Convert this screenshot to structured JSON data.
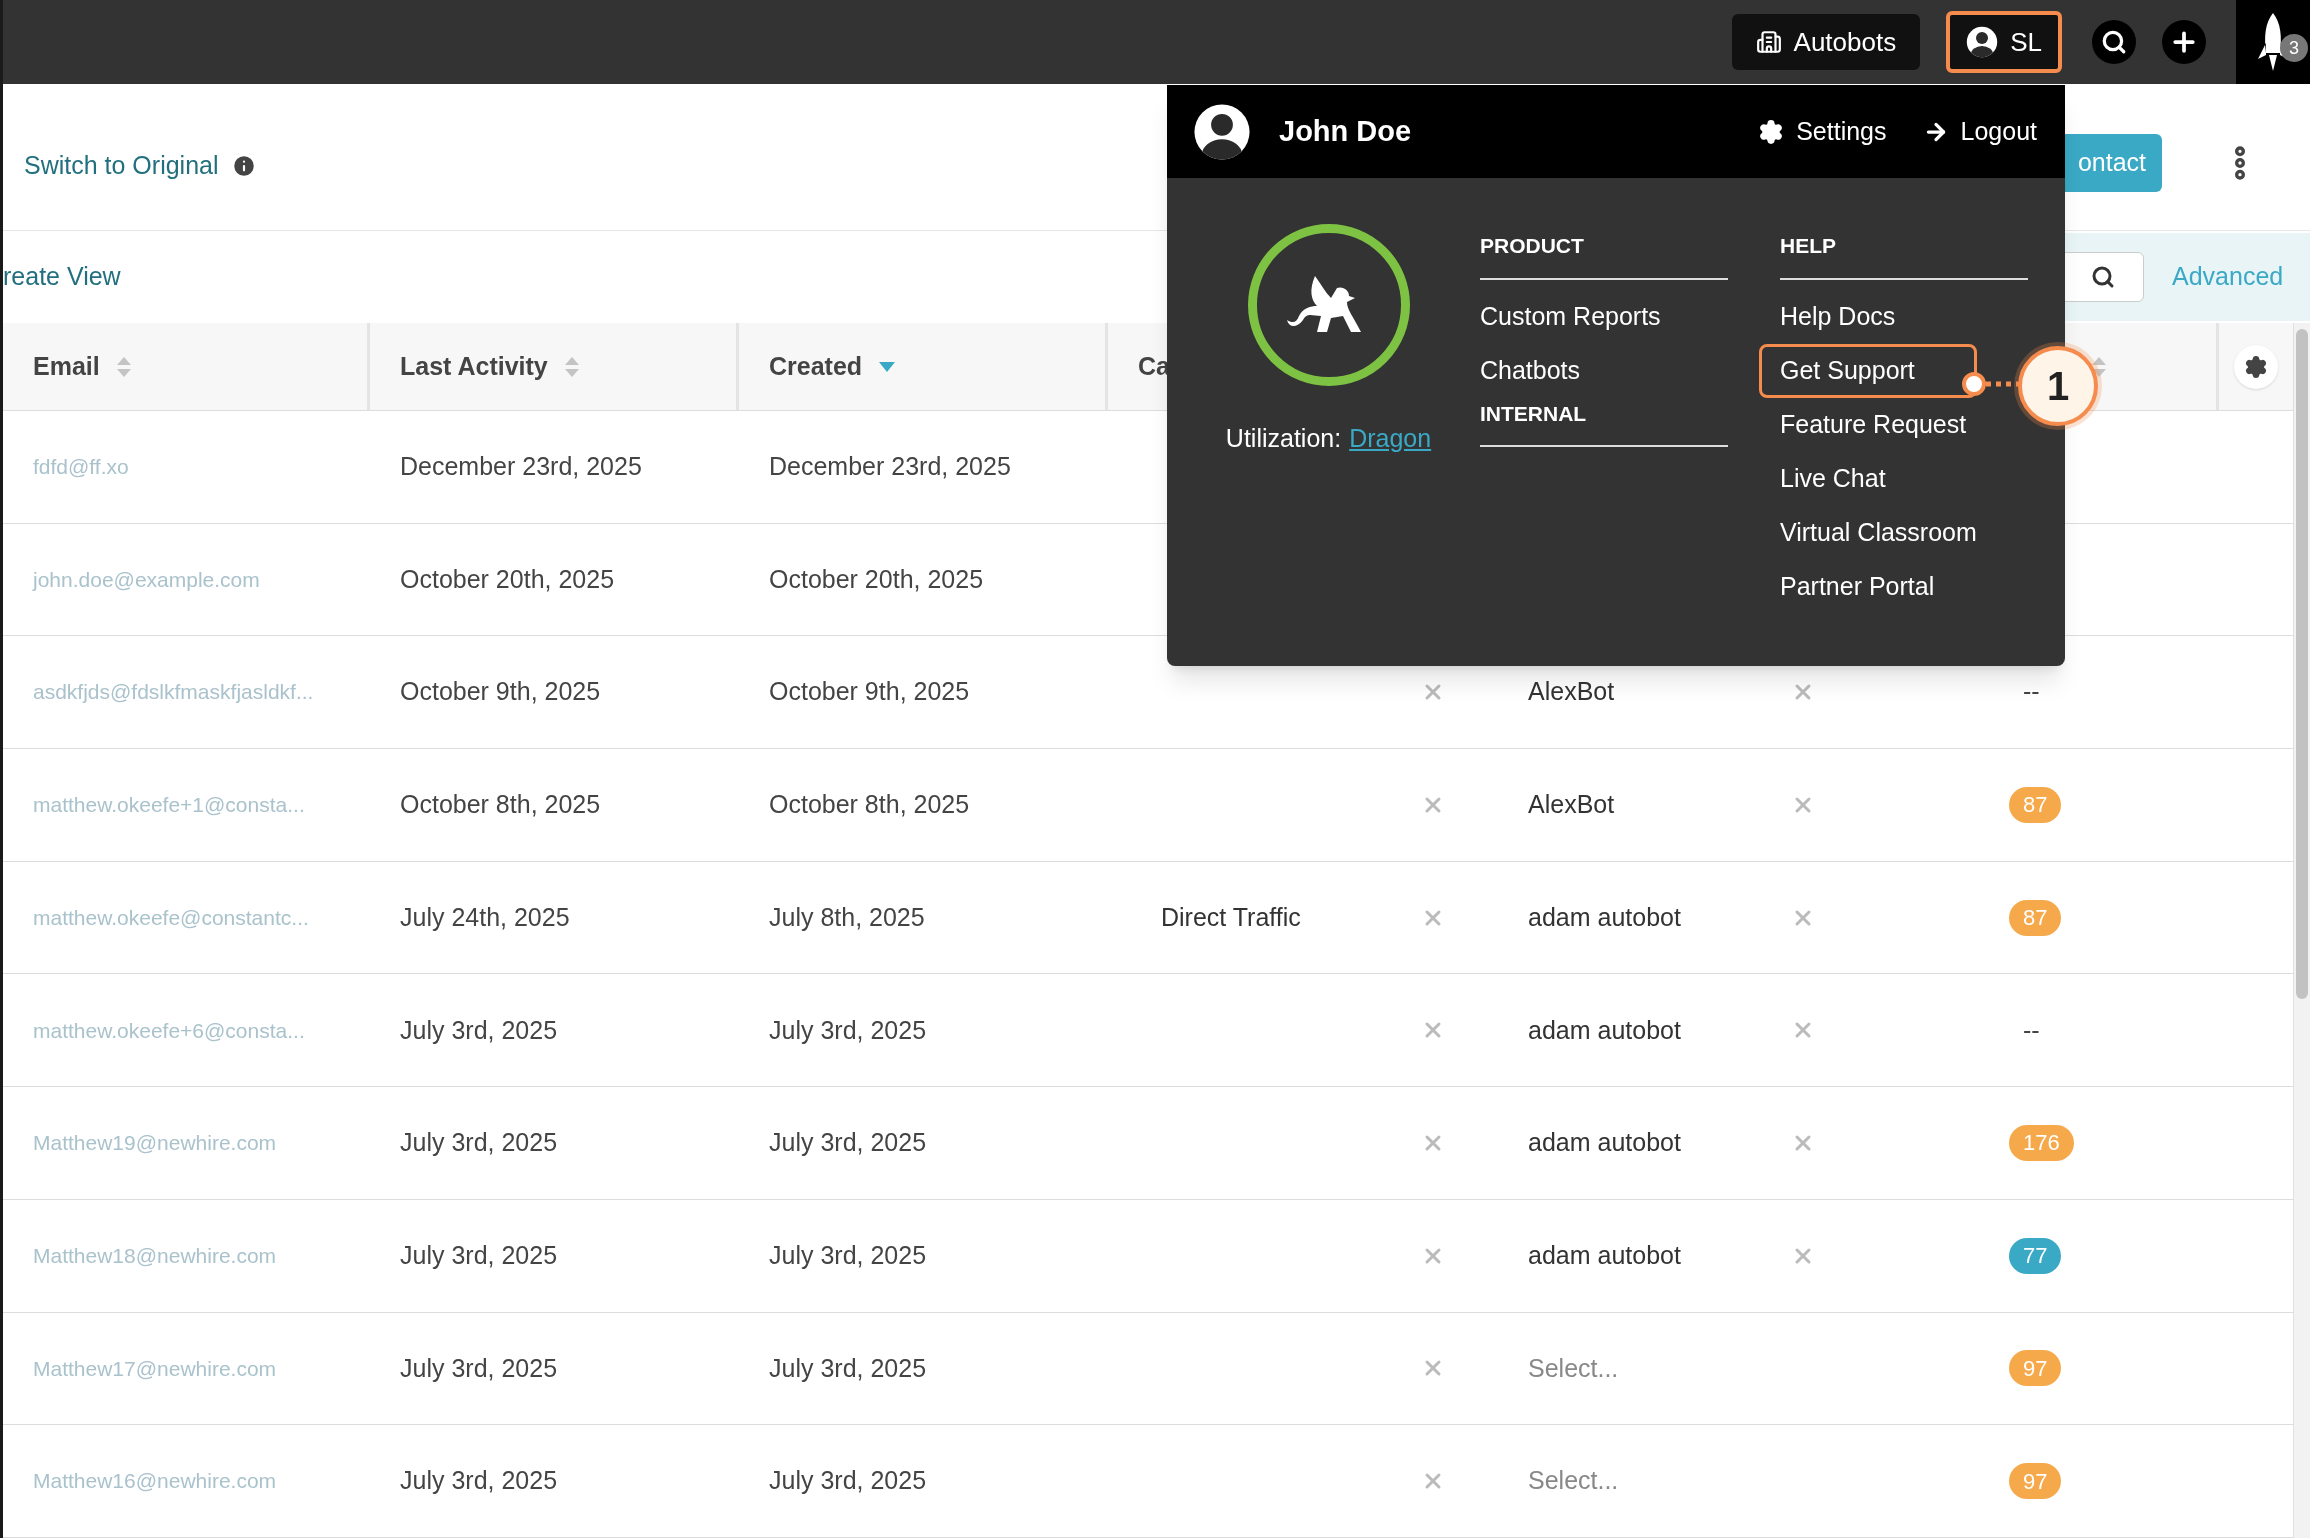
{
  "top_bar": {
    "account_button": "Autobots",
    "user_button": {
      "initials": "SL",
      "highlighted": true
    },
    "notification_count": "3"
  },
  "page_header": {
    "switch_link": "Switch to Original",
    "primary_button": "ontact"
  },
  "view_bar": {
    "create_view_link": "reate View",
    "advanced_link": "Advanced"
  },
  "table": {
    "columns": [
      {
        "label": "Email",
        "sorted": false
      },
      {
        "label": "Last Activity",
        "sorted": false
      },
      {
        "label": "Created",
        "sorted": true
      },
      {
        "label": "Ca"
      }
    ],
    "score_column": {
      "sorted": false
    },
    "rows": [
      {
        "email": "fdfd@ff.xo",
        "last_activity": "December 23rd, 2025",
        "created": "December 23rd, 2025"
      },
      {
        "email": "john.doe@example.com",
        "last_activity": "October 20th, 2025",
        "created": "October 20th, 2025"
      },
      {
        "email": "asdkfjds@fdslkfmaskfjasldkf...",
        "last_activity": "October 9th, 2025",
        "created": "October 9th, 2025",
        "bot": {
          "value": "AlexBot"
        },
        "score": {
          "text": "--"
        }
      },
      {
        "email": "matthew.okeefe+1@consta...",
        "last_activity": "October 8th, 2025",
        "created": "October 8th, 2025",
        "bot": {
          "value": "AlexBot"
        },
        "score": {
          "text": "87",
          "color": "#f5a94a"
        }
      },
      {
        "email": "matthew.okeefe@constantc...",
        "last_activity": "July 24th, 2025",
        "created": "July 8th, 2025",
        "column_4": "Direct Traffic",
        "bot": {
          "value": "adam autobot"
        },
        "score": {
          "text": "87",
          "color": "#f5a94a"
        }
      },
      {
        "email": "matthew.okeefe+6@consta...",
        "last_activity": "July 3rd, 2025",
        "created": "July 3rd, 2025",
        "bot": {
          "value": "adam autobot"
        },
        "score": {
          "text": "--"
        }
      },
      {
        "email": "Matthew19@newhire.com",
        "last_activity": "July 3rd, 2025",
        "created": "July 3rd, 2025",
        "bot": {
          "value": "adam autobot"
        },
        "score": {
          "text": "176",
          "color": "#f5a94a"
        }
      },
      {
        "email": "Matthew18@newhire.com",
        "last_activity": "July 3rd, 2025",
        "created": "July 3rd, 2025",
        "bot": {
          "value": "adam autobot"
        },
        "score": {
          "text": "77",
          "color": "#3aa9c5"
        }
      },
      {
        "email": "Matthew17@newhire.com",
        "last_activity": "July 3rd, 2025",
        "created": "July 3rd, 2025",
        "bot": {
          "placeholder": "Select..."
        },
        "score": {
          "text": "97",
          "color": "#f5a94a"
        }
      },
      {
        "email": "Matthew16@newhire.com",
        "last_activity": "July 3rd, 2025",
        "created": "July 3rd, 2025",
        "bot": {
          "placeholder": "Select..."
        },
        "score": {
          "text": "97",
          "color": "#f5a94a"
        }
      }
    ]
  },
  "user_menu": {
    "user_name": "John Doe",
    "settings": "Settings",
    "logout": "Logout",
    "utilization_label": "Utilization:",
    "utilization_link": "Dragon",
    "columns": [
      {
        "groups": [
          {
            "title": "PRODUCT",
            "items": [
              {
                "label": "Custom Reports",
                "highlighted": false
              },
              {
                "label": "Chatbots",
                "highlighted": false
              }
            ]
          },
          {
            "title": "INTERNAL"
          }
        ]
      },
      {
        "groups": [
          {
            "title": "HELP",
            "items": [
              {
                "label": "Help Docs",
                "highlighted": false
              },
              {
                "label": "Get Support",
                "highlighted": true
              },
              {
                "label": "Feature Request",
                "highlighted": false
              },
              {
                "label": "Live Chat",
                "highlighted": false
              },
              {
                "label": "Virtual Classroom",
                "highlighted": false
              },
              {
                "label": "Partner Portal",
                "highlighted": false
              }
            ]
          }
        ]
      }
    ]
  },
  "callout": {
    "number": "1"
  }
}
